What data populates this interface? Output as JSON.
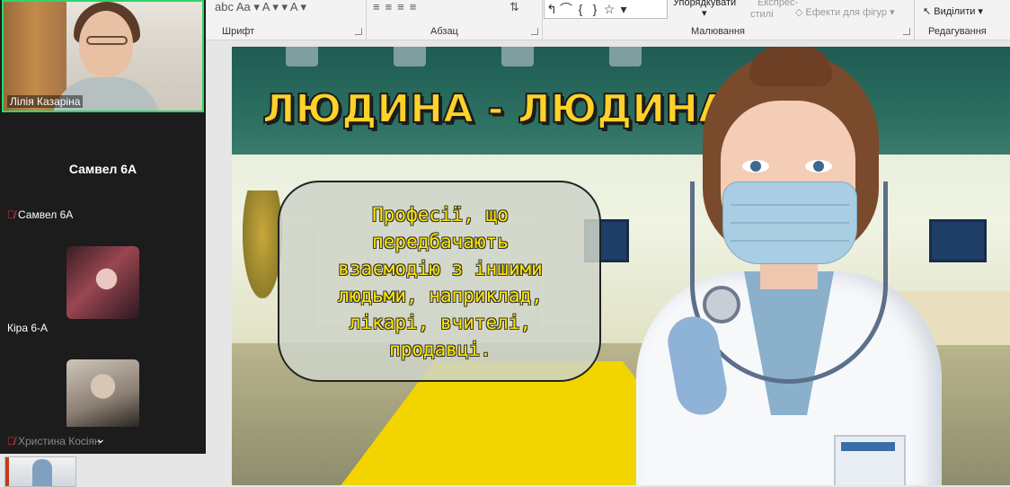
{
  "ribbon": {
    "font_row_glyphs": "abc  Aa ▾  A ▾  ▾  A ▾",
    "groups": {
      "font": "Шрифт",
      "paragraph": "Абзац",
      "drawing": "Малювання",
      "editing": "Редагування"
    },
    "shapes_glyphs": [
      "↰",
      "⌒",
      "{",
      "}",
      "☆"
    ],
    "arrange": "Упорядкувати",
    "quick_styles_line1": "Експрес-",
    "quick_styles_line2": "стилі",
    "shape_effects": "Ефекти для фігур",
    "select": "Виділити"
  },
  "participants": {
    "main_camera_name": "Лілія Казаріна",
    "tile_center_name": "Самвел 6А",
    "tile_label_muted": "Самвел 6А",
    "kira_label": "Кіра 6-А",
    "khrystyna_label": "Христина Косіян"
  },
  "slide": {
    "title": "ЛЮДИНА - ЛЮДИНА",
    "bubble_lines": [
      "Професії, що",
      "передбачають",
      "взаємодію з іншими",
      "людьми, наприклад,",
      "лікарі, вчителі,",
      "продавці."
    ]
  },
  "colors": {
    "active_speaker": "#2dd56a",
    "muted": "#e2344b",
    "title_fill": "#ffd22a",
    "bubble_text": "#ffe600"
  },
  "icons": [
    "mic-muted-icon",
    "chevron-down-icon",
    "select-arrow-icon",
    "dialog-launcher-icon"
  ]
}
